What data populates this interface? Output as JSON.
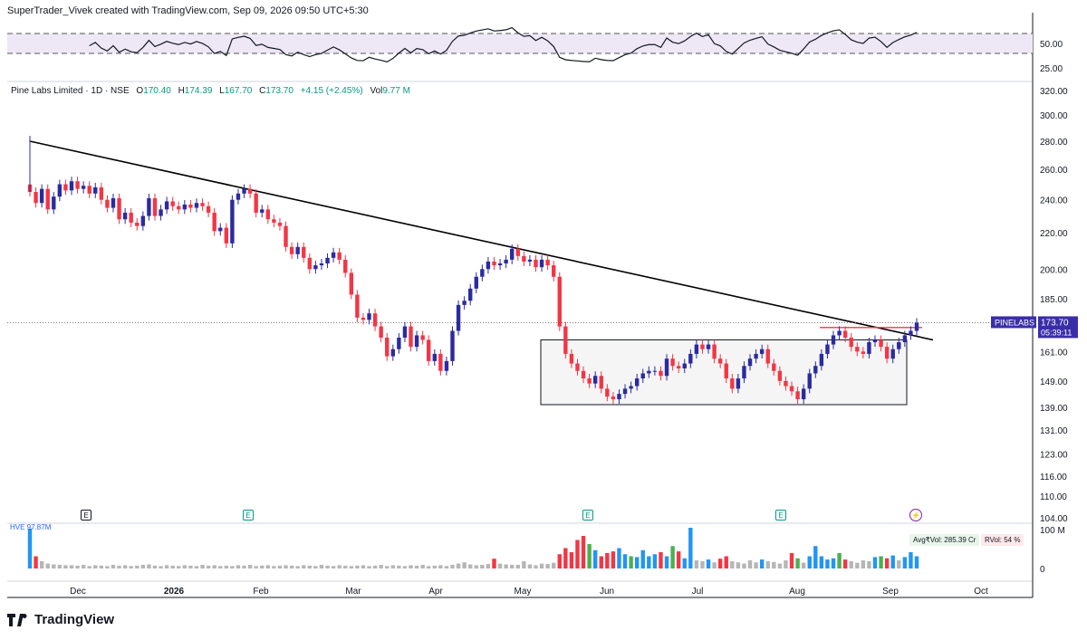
{
  "credit": "SuperTrader_Vivek created with TradingView.com, Sep 09, 2026 09:50 UTC+5:30",
  "brand": "TradingView",
  "symbol": {
    "name": "Pine Labs Limited · 1D · NSE",
    "open_label": "O",
    "open": "170.40",
    "high_label": "H",
    "high": "174.39",
    "low_label": "L",
    "low": "167.70",
    "close_label": "C",
    "close": "173.70",
    "change": "+4.15 (+2.45%)",
    "vol_label": "Vol",
    "vol": "9.77 M"
  },
  "price_tag": {
    "ticker": "PINELABS",
    "price": "173.70",
    "timer": "05:39:11"
  },
  "volume_panel": {
    "title": "HVE 97.87M",
    "avg": "Avg₹Vol: 285.39 Cr",
    "rvol": "RVol: 54 %",
    "ticks": [
      "100 M",
      "0"
    ]
  },
  "rsi_panel": {
    "ticks": [
      "50.00",
      "25.00"
    ]
  },
  "events": [
    {
      "letter": "E",
      "kind": "dividend",
      "label_x": "Dec"
    },
    {
      "letter": "E",
      "kind": "earnings"
    },
    {
      "letter": "E",
      "kind": "earnings"
    },
    {
      "letter": "E",
      "kind": "earnings"
    },
    {
      "letter": "⚡",
      "kind": "flash"
    }
  ],
  "colors": {
    "up": "#2b2ba0",
    "down": "#f23645",
    "vol_up": "#2196f3",
    "vol_down": "#f23645",
    "vol_mid": "#4caf50",
    "vol_neutral": "#9e9e9e",
    "rsi_band": "#ede7f6",
    "accent": "#3a2ea8"
  },
  "chart_data": {
    "type": "candlestick",
    "title": "",
    "y_scale": "log",
    "price_axis_ticks": [
      320.0,
      300.0,
      280.0,
      260.0,
      240.0,
      220.0,
      200.0,
      185.0,
      173.7,
      161.0,
      149.0,
      139.0,
      131.0,
      123.0,
      116.0,
      110.0,
      104.0
    ],
    "price_axis_labels": [
      "320.00",
      "300.00",
      "280.00",
      "260.00",
      "240.00",
      "220.00",
      "200.00",
      "185.00",
      "161.00",
      "149.00",
      "139.00",
      "131.00",
      "123.00",
      "116.00",
      "110.00",
      "104.00"
    ],
    "x_ticks": [
      "Dec",
      "2026",
      "Feb",
      "Mar",
      "Apr",
      "May",
      "Jun",
      "Jul",
      "Aug",
      "Sep",
      "Oct"
    ],
    "last_price": 173.7,
    "trendline": {
      "from": 280,
      "to": 166
    },
    "range_box": {
      "top": 166,
      "bottom": 140
    },
    "resistance": 171.5,
    "closes": [
      245,
      238,
      247,
      234,
      242,
      250,
      246,
      252,
      247,
      249,
      244,
      248,
      240,
      235,
      241,
      228,
      232,
      226,
      224,
      230,
      241,
      230,
      234,
      239,
      236,
      234,
      237,
      235,
      238,
      236,
      232,
      221,
      223,
      214,
      240,
      244,
      247,
      244,
      232,
      234,
      228,
      226,
      224,
      212,
      208,
      212,
      206,
      200,
      202,
      203,
      206,
      209,
      205,
      198,
      187,
      176,
      175,
      178,
      172,
      167,
      159,
      162,
      167,
      172,
      163,
      168,
      166,
      157,
      160,
      153,
      157,
      170,
      182,
      184,
      190,
      196,
      200,
      204,
      202,
      203,
      205,
      211,
      207,
      204,
      205,
      201,
      205,
      202,
      196,
      172,
      160,
      156,
      153,
      150,
      148,
      151,
      146,
      143,
      142,
      144,
      146,
      147,
      150,
      152,
      153,
      153,
      151,
      158,
      155,
      154,
      156,
      160,
      164,
      162,
      164,
      158,
      156,
      150,
      146,
      150,
      155,
      158,
      160,
      162,
      156,
      153,
      149,
      147,
      145,
      142,
      146,
      152,
      155,
      160,
      164,
      168,
      170,
      167,
      163,
      161,
      160,
      165,
      166,
      163,
      158,
      162,
      165,
      168,
      170,
      173.7
    ],
    "volumes_M": [
      97.87,
      30,
      18,
      12,
      10,
      9,
      8,
      8,
      7,
      9,
      6,
      8,
      7,
      6,
      9,
      7,
      8,
      6,
      7,
      9,
      10,
      7,
      6,
      8,
      7,
      6,
      8,
      7,
      6,
      9,
      7,
      8,
      6,
      7,
      6,
      8,
      7,
      9,
      6,
      7,
      8,
      6,
      7,
      8,
      7,
      6,
      8,
      7,
      6,
      9,
      7,
      6,
      8,
      7,
      6,
      7,
      8,
      6,
      7,
      9,
      6,
      8,
      7,
      6,
      8,
      7,
      9,
      6,
      7,
      8,
      6,
      9,
      12,
      15,
      10,
      8,
      9,
      11,
      24,
      12,
      10,
      9,
      9,
      18,
      10,
      8,
      12,
      11,
      14,
      35,
      50,
      40,
      70,
      80,
      60,
      45,
      30,
      38,
      42,
      50,
      35,
      30,
      28,
      45,
      30,
      35,
      40,
      30,
      55,
      42,
      25,
      100,
      20,
      18,
      22,
      15,
      24,
      30,
      18,
      15,
      12,
      20,
      15,
      22,
      18,
      16,
      12,
      20,
      38,
      25,
      14,
      30,
      55,
      30,
      22,
      25,
      38,
      22,
      18,
      14,
      20,
      18,
      28,
      30,
      25,
      32,
      20,
      28,
      40,
      30
    ]
  }
}
